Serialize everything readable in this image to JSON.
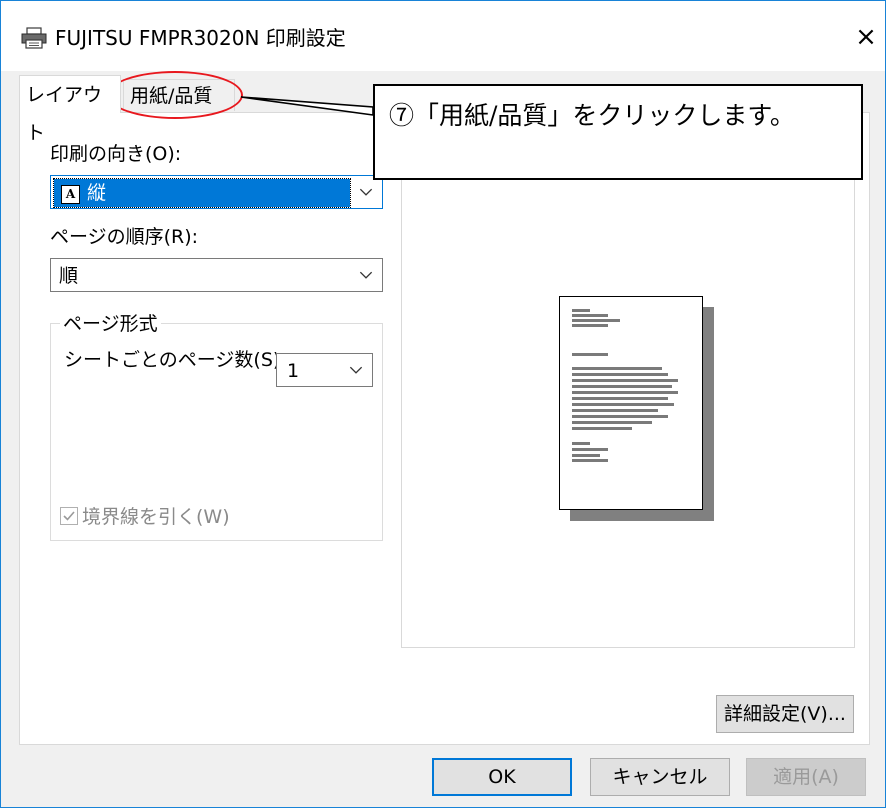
{
  "window": {
    "title": "FUJITSU FMPR3020N 印刷設定",
    "close_symbol": "×"
  },
  "tabs": [
    {
      "label": "レイアウト",
      "active": true
    },
    {
      "label": "用紙/品質",
      "active": false
    }
  ],
  "orientation": {
    "label": "印刷の向き(O):",
    "value": "縦",
    "icon_glyph": "A"
  },
  "page_order": {
    "label": "ページの順序(R):",
    "value": "順"
  },
  "page_format": {
    "group_title": "ページ形式",
    "pages_per_sheet_label": "シートごとのページ数(S)",
    "pages_per_sheet_value": "1",
    "borders_label": "境界線を引く(W)",
    "borders_checked": true,
    "borders_enabled": false
  },
  "buttons": {
    "advanced": "詳細設定(V)...",
    "ok": "OK",
    "cancel": "キャンセル",
    "apply": "適用(A)"
  },
  "annotation": {
    "callout_text": "⑦「用紙/品質」をクリックします。",
    "highlight_color": "#e8181e"
  },
  "colors": {
    "accent": "#0078d7",
    "window_border": "#1883d7"
  }
}
